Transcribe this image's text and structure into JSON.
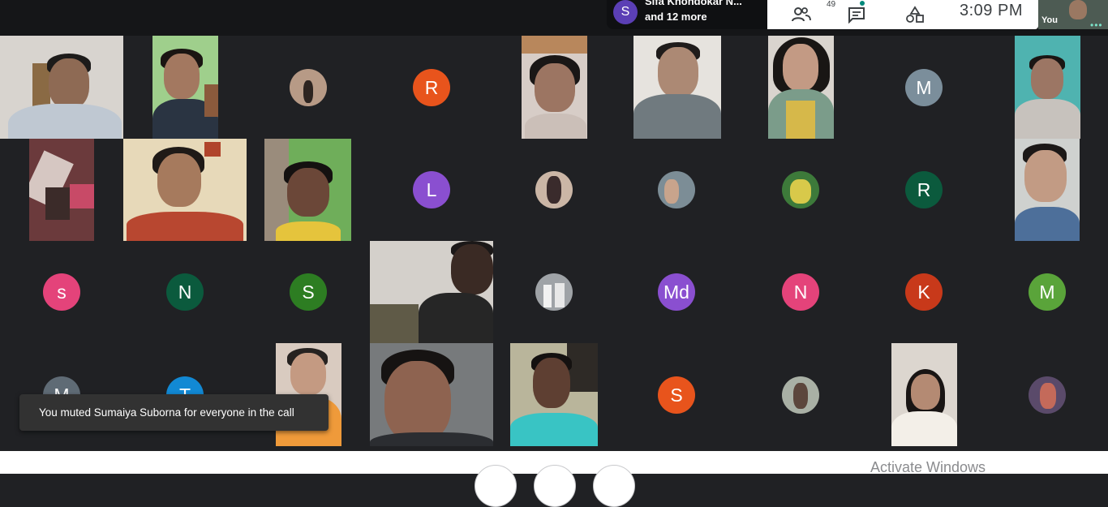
{
  "meeting": {
    "presenter_initial": "S",
    "presenter_name": "Sifa Khondokar N...",
    "presenter_more": "and 12 more",
    "participant_count": "49",
    "time": "3:09  PM",
    "self_label": "You"
  },
  "avatars": [
    {
      "letter": "R",
      "color": "#e8541c"
    },
    {
      "letter": "M",
      "color": "#7b8e9b"
    },
    {
      "letter": "L",
      "color": "#8a4fd0"
    },
    {
      "letter": "R",
      "color": "#0b5a3d"
    },
    {
      "letter": "s",
      "color": "#e4437a"
    },
    {
      "letter": "N",
      "color": "#0b5a3d"
    },
    {
      "letter": "S",
      "color": "#2d7d22"
    },
    {
      "letter": "Md",
      "color": "#8a4fd0"
    },
    {
      "letter": "N",
      "color": "#e4437a"
    },
    {
      "letter": "K",
      "color": "#c8391a"
    },
    {
      "letter": "M",
      "color": "#5aa43a"
    },
    {
      "letter": "M",
      "color": "#5f6b75"
    },
    {
      "letter": "T",
      "color": "#1289d4"
    },
    {
      "letter": "S",
      "color": "#e8541c"
    }
  ],
  "toast": {
    "message": "You muted Sumaiya Suborna for everyone in the call"
  },
  "os": {
    "watermark": "Activate Windows"
  }
}
